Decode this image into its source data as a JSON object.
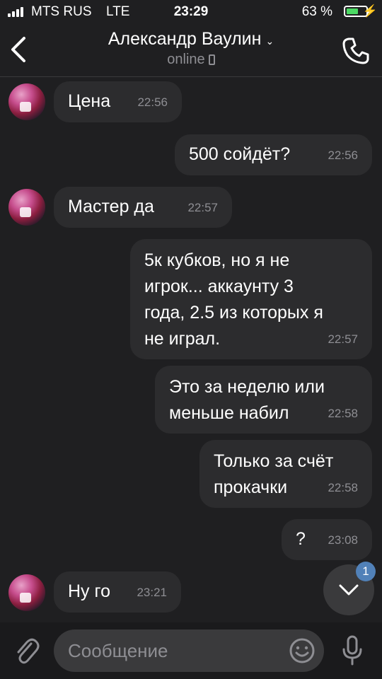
{
  "status_bar": {
    "carrier": "MTS RUS",
    "network": "LTE",
    "time": "23:29",
    "battery_percent": "63 %",
    "battery_level": 0.63,
    "battery_color": "#4cd964"
  },
  "header": {
    "back_icon": "chevron-left-icon",
    "title": "Александр Ваулин",
    "title_chevron": "⌄",
    "presence": "online",
    "call_icon": "phone-icon"
  },
  "messages": [
    {
      "side": "in",
      "text": "Цена",
      "time": "22:56"
    },
    {
      "side": "out",
      "text": "500 сойдёт?",
      "time": "22:56"
    },
    {
      "side": "in",
      "text": "Мастер да",
      "time": "22:57"
    },
    {
      "side": "out",
      "text": "5к кубков, но я не\nигрок... аккаунту 3\nгода, 2.5 из которых я\nне играл.",
      "time": "22:57"
    },
    {
      "side": "out",
      "text": "Это за неделю или\nменьше набил",
      "time": "22:58"
    },
    {
      "side": "out",
      "text": "Только за счёт\nпрокачки",
      "time": "22:58"
    },
    {
      "side": "out",
      "text": "?",
      "time": "23:08"
    },
    {
      "side": "in",
      "text": "Ну го",
      "time": "23:21"
    }
  ],
  "scroll_button": {
    "icon": "chevron-down-icon",
    "badge": "1"
  },
  "composer": {
    "placeholder": "Сообщение",
    "attach_icon": "paperclip-icon",
    "emoji_icon": "smile-icon",
    "mic_icon": "microphone-icon"
  },
  "colors": {
    "background": "#1f1f21",
    "bubble": "#2c2c2e",
    "accent": "#5181b8"
  }
}
